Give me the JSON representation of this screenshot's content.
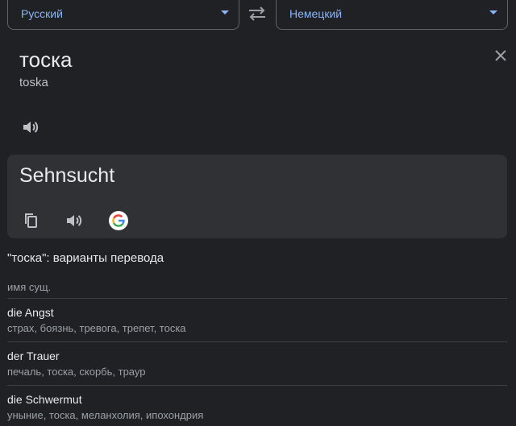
{
  "languages": {
    "source": "Русский",
    "target": "Немецкий"
  },
  "source": {
    "word": "тоска",
    "transliteration": "toska"
  },
  "result": {
    "word": "Sehnsucht"
  },
  "variants": {
    "title": "\"тоска\": варианты перевода",
    "part_of_speech": "имя сущ.",
    "entries": [
      {
        "term": "die Angst",
        "synonyms": "страх, боязнь, тревога, трепет, тоска"
      },
      {
        "term": "der Trauer",
        "synonyms": "печаль, тоска, скорбь, траур"
      },
      {
        "term": "die Schwermut",
        "synonyms": "уныние, тоска, меланхолия, ипохондрия"
      }
    ]
  },
  "colors": {
    "background": "#202124",
    "card": "#303134",
    "accent": "#8ab4f8",
    "text": "#e8eaed",
    "muted": "#9aa0a6"
  },
  "icons": [
    "chevron-down-icon",
    "swap-icon",
    "close-icon",
    "speaker-icon",
    "copy-icon",
    "google-icon"
  ]
}
